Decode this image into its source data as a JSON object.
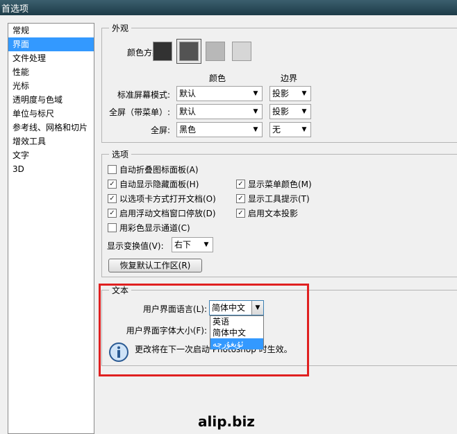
{
  "window": {
    "title": "首选项"
  },
  "sidebar": {
    "items": [
      {
        "label": "常规"
      },
      {
        "label": "界面",
        "selected": true
      },
      {
        "label": "文件处理"
      },
      {
        "label": "性能"
      },
      {
        "label": "光标"
      },
      {
        "label": "透明度与色域"
      },
      {
        "label": "单位与标尺"
      },
      {
        "label": "参考线、网格和切片"
      },
      {
        "label": "增效工具"
      },
      {
        "label": "文字"
      },
      {
        "label": "3D"
      }
    ]
  },
  "appearance": {
    "legend": "外观",
    "color_scheme_label": "颜色方案:",
    "swatches": [
      "#323232",
      "#535353",
      "#b8b8b8",
      "#d6d6d6"
    ],
    "col_color": "颜色",
    "col_border": "边界",
    "rows": [
      {
        "label": "标准屏幕模式:",
        "color": "默认",
        "border": "投影"
      },
      {
        "label": "全屏（带菜单）:",
        "color": "默认",
        "border": "投影"
      },
      {
        "label": "全屏:",
        "color": "黑色",
        "border": "无"
      }
    ]
  },
  "options": {
    "legend": "选项",
    "checks": [
      {
        "label": "自动折叠图标面板(A)",
        "checked": false
      },
      {
        "label": "自动显示隐藏面板(H)",
        "checked": true
      },
      {
        "label": "以选项卡方式打开文档(O)",
        "checked": true
      },
      {
        "label": "启用浮动文档窗口停放(D)",
        "checked": true
      },
      {
        "label": "用彩色显示通道(C)",
        "checked": false
      },
      {
        "label": "显示菜单颜色(M)",
        "checked": true
      },
      {
        "label": "显示工具提示(T)",
        "checked": true
      },
      {
        "label": "启用文本投影",
        "checked": true
      }
    ],
    "transform_label": "显示变换值(V):",
    "transform_value": "右下",
    "restore_button": "恢复默认工作区(R)"
  },
  "text_section": {
    "legend": "文本",
    "language_label": "用户界面语言(L):",
    "language_value": "简体中文",
    "font_size_label": "用户界面字体大小(F):",
    "language_options": [
      "英语",
      "简体中文",
      "ئۇيغۇرچە"
    ],
    "highlighted_option": 2,
    "info_text": "更改将在下一次启动 Photoshop 时生效。"
  },
  "watermark": "alip.biz",
  "colors": {
    "selection": "#3399ff",
    "annotation": "#e02020"
  }
}
